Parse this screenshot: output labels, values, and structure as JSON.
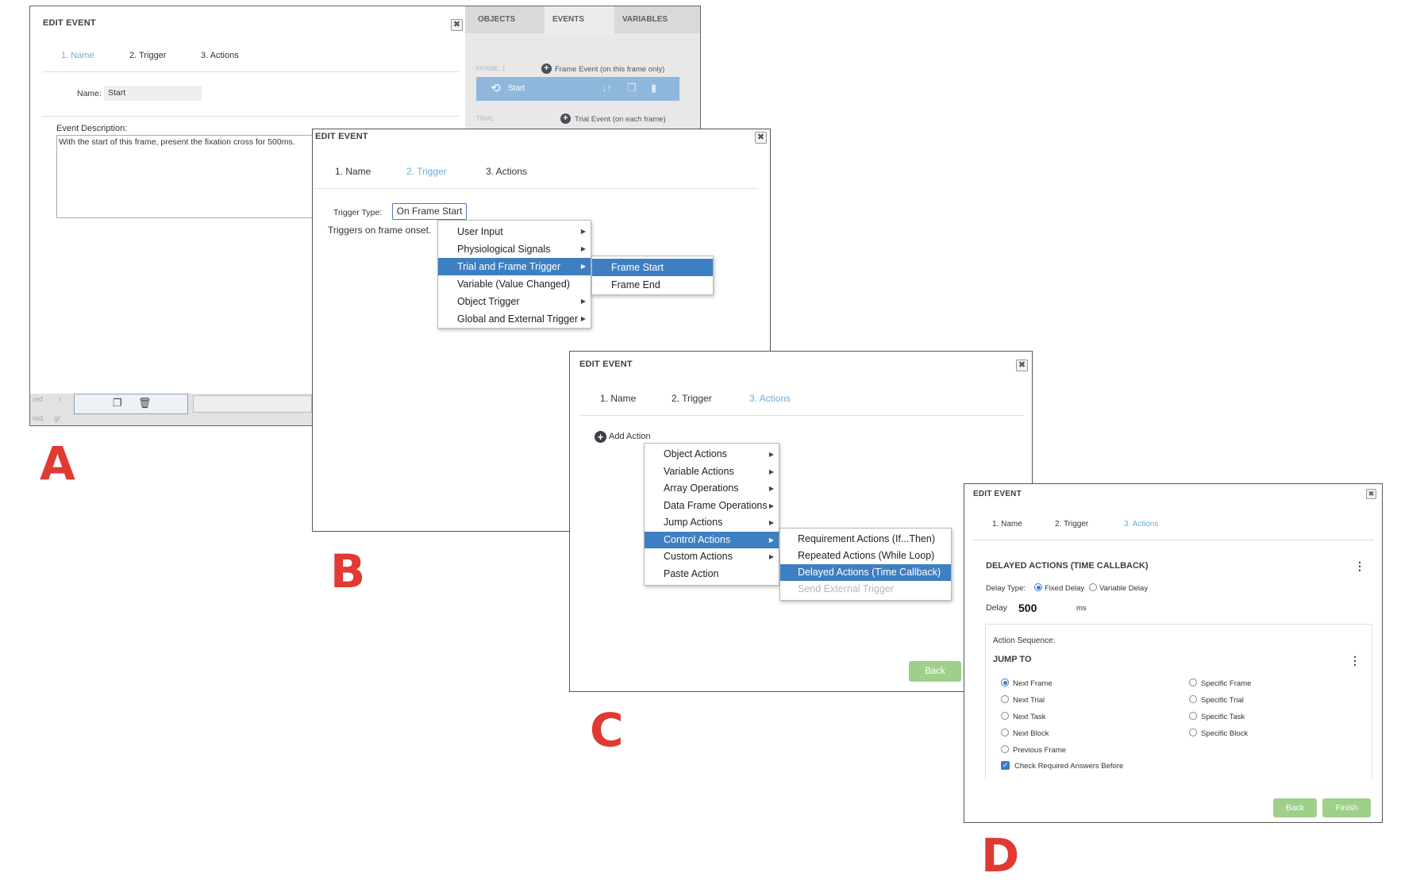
{
  "labels": {
    "a": "A",
    "b": "B",
    "c": "C",
    "d": "D"
  },
  "panel_a": {
    "title": "EDIT EVENT",
    "close": "✖",
    "tabs": [
      "1. Name",
      "2. Trigger",
      "3. Actions"
    ],
    "name_label": "Name:",
    "name_value": "Start",
    "desc_label": "Event Description:",
    "desc_value": "With the start of this frame, present the fixation cross for 500ms.",
    "side_tabs": [
      "OBJECTS",
      "EVENTS",
      "VARIABLES"
    ],
    "frame_label": "FRAME: 1",
    "frame_event": "Frame Event (on this frame only)",
    "start_item": "Start",
    "trial_label": "TRIAL",
    "trial_event": "Trial Event (on each frame)",
    "left_frags": [
      "red",
      "red",
      "r",
      "gr"
    ]
  },
  "panel_b": {
    "title": "EDIT EVENT",
    "close": "✖",
    "tabs": [
      "1. Name",
      "2. Trigger",
      "3. Actions"
    ],
    "trigger_type_label": "Trigger Type:",
    "trigger_type_value": "On Frame Start",
    "trigger_desc": "Triggers on frame onset.",
    "menu": [
      "User Input",
      "Physiological Signals",
      "Trial and Frame Trigger",
      "Variable (Value Changed)",
      "Object Trigger",
      "Global and External Trigger"
    ],
    "submenu": [
      "Frame Start",
      "Frame End"
    ]
  },
  "panel_c": {
    "title": "EDIT EVENT",
    "close": "✖",
    "tabs": [
      "1. Name",
      "2. Trigger",
      "3. Actions"
    ],
    "add_action": "Add Action",
    "menu": [
      "Object Actions",
      "Variable Actions",
      "Array Operations",
      "Data Frame Operations",
      "Jump Actions",
      "Control Actions",
      "Custom Actions",
      "Paste Action"
    ],
    "submenu": [
      "Requirement Actions (If...Then)",
      "Repeated Actions (While Loop)",
      "Delayed Actions (Time Callback)",
      "Send External Trigger"
    ],
    "back": "Back"
  },
  "panel_d": {
    "title": "EDIT EVENT",
    "close": "✖",
    "tabs": [
      "1. Name",
      "2. Trigger",
      "3. Actions"
    ],
    "section_title": "DELAYED ACTIONS (TIME CALLBACK)",
    "delay_type_label": "Delay Type:",
    "fixed_delay": "Fixed Delay",
    "variable_delay": "Variable Delay",
    "delay_label": "Delay",
    "delay_value": "500",
    "delay_unit": "ms",
    "action_sequence": "Action Sequence:",
    "jump_to": "JUMP TO",
    "options_left": [
      "Next Frame",
      "Next Trial",
      "Next Task",
      "Next Block",
      "Previous Frame"
    ],
    "options_right": [
      "Specific Frame",
      "Specific Trial",
      "Specific Task",
      "Specific Block"
    ],
    "check_label": "Check Required Answers Before",
    "back": "Back",
    "finish": "Finish"
  }
}
